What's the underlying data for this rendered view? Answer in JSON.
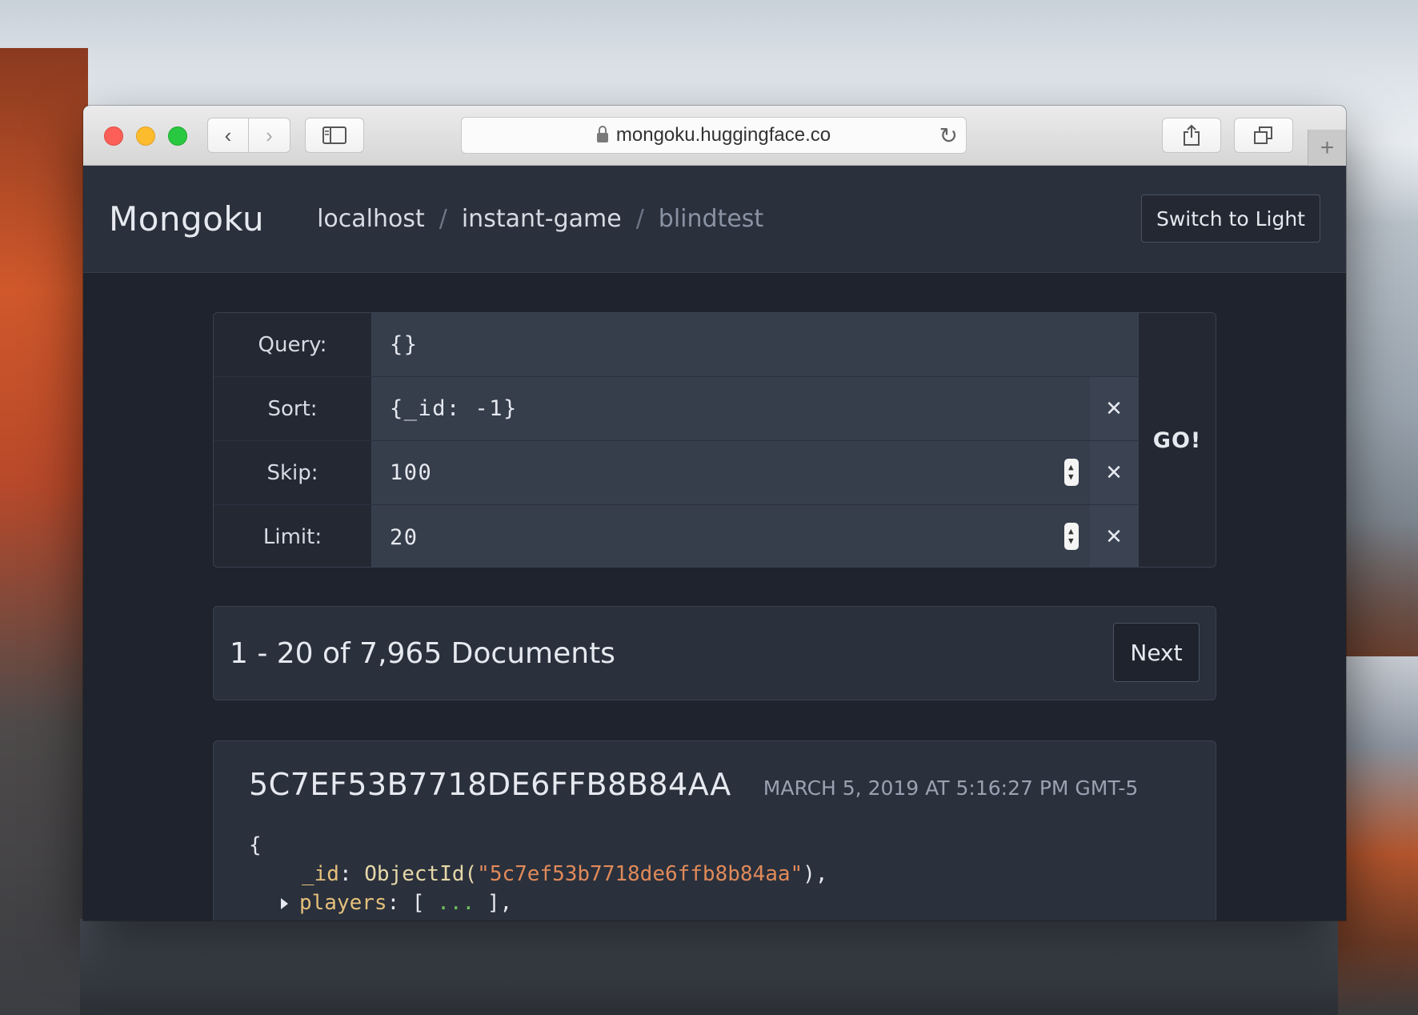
{
  "browser": {
    "url": "mongoku.huggingface.co"
  },
  "app": {
    "brand": "Mongoku",
    "breadcrumbs": [
      "localhost",
      "instant-game",
      "blindtest"
    ],
    "breadcrumb_separator": "/",
    "theme_toggle_label": "Switch to Light"
  },
  "query": {
    "query_label": "Query:",
    "query_value": "{}",
    "sort_label": "Sort:",
    "sort_value": "{_id: -1}",
    "skip_label": "Skip:",
    "skip_value": "100",
    "limit_label": "Limit:",
    "limit_value": "20",
    "clear_symbol": "✕",
    "go_label": "GO!"
  },
  "results": {
    "summary": "1 - 20 of 7,965 Documents",
    "next_label": "Next"
  },
  "document": {
    "id": "5C7EF53B7718DE6FFB8B84AA",
    "date": "MARCH 5, 2019 AT 5:16:27 PM GMT-5",
    "open_brace": "{",
    "id_key": "_id",
    "id_fn": "ObjectId(",
    "id_value": "\"5c7ef53b7718de6ffb8b84aa\"",
    "id_close": "),",
    "players_key": "players",
    "players_open": "[",
    "players_ellipsis": "...",
    "players_close": "],"
  }
}
